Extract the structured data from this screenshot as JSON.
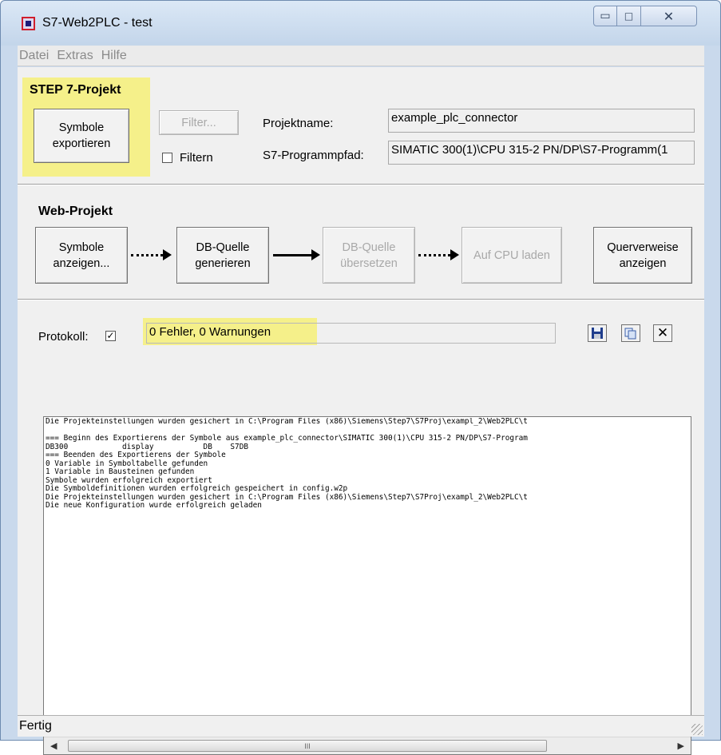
{
  "window": {
    "title": "S7-Web2PLC - test",
    "controls": {
      "minimize": "▭",
      "maximize": "□",
      "close": "✕"
    }
  },
  "menu": [
    "Datei",
    "Extras",
    "Hilfe"
  ],
  "step7": {
    "heading": "STEP 7-Projekt",
    "export_button": "Symbole\nexportieren",
    "filter_button": "Filter...",
    "filter_checkbox_label": "Filtern",
    "projectname_label": "Projektname:",
    "projectname_value": "example_plc_connector",
    "programpath_label": "S7-Programmpfad:",
    "programpath_value": "SIMATIC 300(1)\\CPU 315-2 PN/DP\\S7-Programm(1"
  },
  "web": {
    "heading": "Web-Projekt",
    "show_symbols_button": "Symbole\nanzeigen...",
    "generate_button": "DB-Quelle\ngenerieren",
    "compile_button": "DB-Quelle\nübersetzen",
    "load_button": "Auf CPU laden",
    "xref_button": "Querverweise\nanzeigen"
  },
  "protocol": {
    "label": "Protokoll:",
    "checked_mark": "✓",
    "summary": "0 Fehler, 0 Warnungen",
    "icons": {
      "save": "floppy-disk-icon",
      "copy": "copy-icon",
      "clear": "close-icon"
    },
    "clear_glyph": "✕",
    "log_lines": [
      "Die Projekteinstellungen wurden gesichert in C:\\Program Files (x86)\\Siemens\\Step7\\S7Proj\\exampl_2\\Web2PLC\\t",
      "",
      "=== Beginn des Exportierens der Symbole aus example_plc_connector\\SIMATIC 300(1)\\CPU 315-2 PN/DP\\S7-Program",
      "DB300            display           DB    S7DB",
      "=== Beenden des Exportierens der Symbole",
      "0 Variable in Symboltabelle gefunden",
      "1 Variable in Bausteinen gefunden",
      "Symbole wurden erfolgreich exportiert",
      "Die Symboldefinitionen wurden erfolgreich gespeichert in config.w2p",
      "Die Projekteinstellungen wurden gesichert in C:\\Program Files (x86)\\Siemens\\Step7\\S7Proj\\exampl_2\\Web2PLC\\t",
      "Die neue Konfiguration wurde erfolgreich geladen"
    ],
    "scroll_left": "◀",
    "scroll_right": "▶",
    "scroll_thumb_grip": "III"
  },
  "status": {
    "text": "Fertig"
  },
  "colors": {
    "highlight": "#f5f08a",
    "titlebar": "#c9d9ec",
    "panel": "#f0f0f0"
  }
}
